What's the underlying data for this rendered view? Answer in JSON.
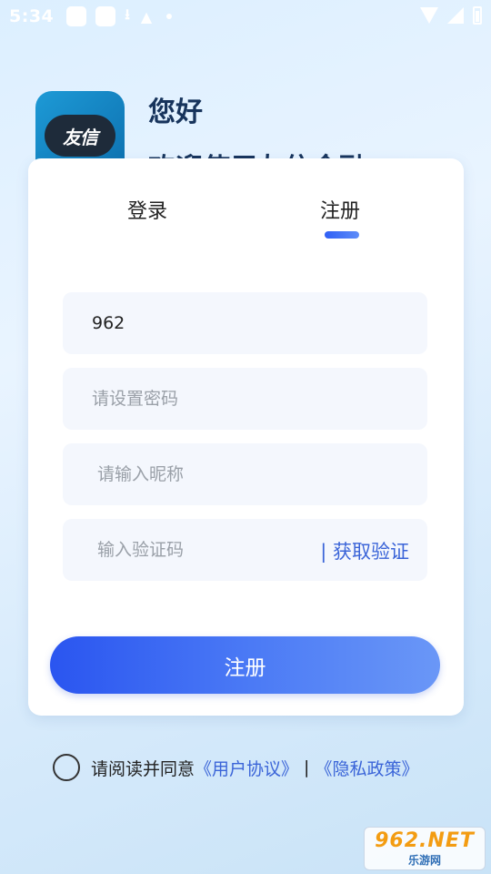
{
  "status_bar": {
    "time": "5:34",
    "icons": [
      "notification-box-icon",
      "notification-box-icon",
      "download-icon",
      "android-icon",
      "dot-icon",
      "wifi-icon",
      "signal-icon",
      "battery-icon"
    ]
  },
  "header": {
    "logo_text": "友信",
    "greeting": "您好",
    "welcome": "欢迎使用友信金融"
  },
  "tabs": [
    {
      "label": "登录",
      "active": false
    },
    {
      "label": "注册",
      "active": true
    }
  ],
  "form": {
    "phone_value": "962",
    "password_placeholder": "请设置密码",
    "nickname_placeholder": "请输入昵称",
    "code_placeholder": "输入验证码",
    "get_code_label": "| 获取验证"
  },
  "submit_label": "注册",
  "agreement": {
    "prefix": "请阅读并同意",
    "user_agreement": "《用户协议》",
    "separator": "|",
    "privacy_policy": "《隐私政策》"
  },
  "watermark": {
    "top": "962.NET",
    "bottom": "乐游网"
  },
  "colors": {
    "accent": "#3a64d8",
    "button_start": "#2a55f0",
    "button_end": "#6a97f7",
    "title": "#17345c"
  }
}
